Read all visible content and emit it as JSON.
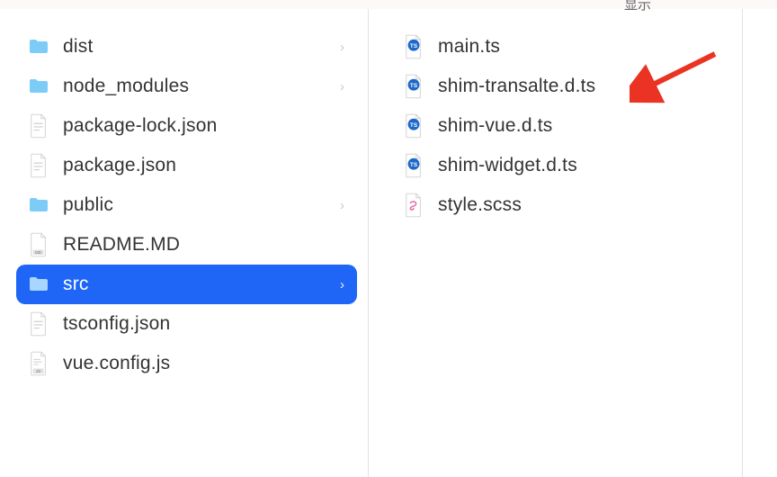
{
  "topbar": {
    "label": "显示"
  },
  "left": {
    "items": [
      {
        "name": "dist",
        "type": "folder",
        "hasChildren": true,
        "selected": false
      },
      {
        "name": "node_modules",
        "type": "folder",
        "hasChildren": true,
        "selected": false
      },
      {
        "name": "package-lock.json",
        "type": "file",
        "subtype": "generic",
        "hasChildren": false,
        "selected": false
      },
      {
        "name": "package.json",
        "type": "file",
        "subtype": "generic",
        "hasChildren": false,
        "selected": false
      },
      {
        "name": "public",
        "type": "folder",
        "hasChildren": true,
        "selected": false
      },
      {
        "name": "README.MD",
        "type": "file",
        "subtype": "md",
        "hasChildren": false,
        "selected": false
      },
      {
        "name": "src",
        "type": "folder",
        "hasChildren": true,
        "selected": true
      },
      {
        "name": "tsconfig.json",
        "type": "file",
        "subtype": "generic",
        "hasChildren": false,
        "selected": false
      },
      {
        "name": "vue.config.js",
        "type": "file",
        "subtype": "js",
        "hasChildren": false,
        "selected": false
      }
    ]
  },
  "right": {
    "items": [
      {
        "name": "main.ts",
        "type": "file",
        "subtype": "ts"
      },
      {
        "name": "shim-transalte.d.ts",
        "type": "file",
        "subtype": "ts"
      },
      {
        "name": "shim-vue.d.ts",
        "type": "file",
        "subtype": "ts"
      },
      {
        "name": "shim-widget.d.ts",
        "type": "file",
        "subtype": "ts"
      },
      {
        "name": "style.scss",
        "type": "file",
        "subtype": "scss"
      }
    ]
  },
  "annotation": {
    "arrow_target": "shim-transalte.d.ts"
  },
  "colors": {
    "selection": "#1f66f7",
    "folder": "#7dccf8",
    "arrow": "#ea3323"
  }
}
